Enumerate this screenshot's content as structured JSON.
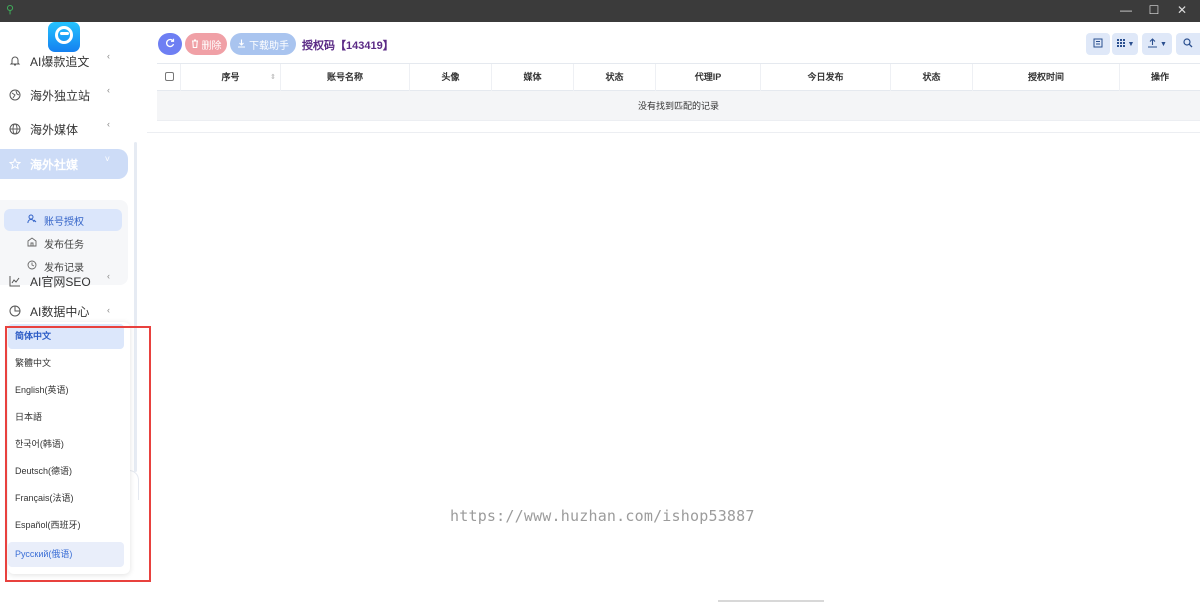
{
  "window": {
    "minimize_glyph": "—",
    "maximize_glyph": "☐",
    "close_glyph": "✕"
  },
  "sidebar": {
    "items": [
      {
        "label": "AI爆款追文",
        "icon": "bell-icon"
      },
      {
        "label": "海外独立站",
        "icon": "globe-icon"
      },
      {
        "label": "海外媒体",
        "icon": "globe-icon"
      },
      {
        "label": "海外社媒",
        "icon": "star-icon"
      },
      {
        "label": "AI官网SEO",
        "icon": "chart-line-icon"
      },
      {
        "label": "AI数据中心",
        "icon": "pie-chart-icon"
      }
    ],
    "submenu": [
      {
        "label": "账号授权",
        "icon": "user-key-icon"
      },
      {
        "label": "发布任务",
        "icon": "building-icon"
      },
      {
        "label": "发布记录",
        "icon": "clock-icon"
      }
    ]
  },
  "language_menu": {
    "options": [
      "简体中文",
      "繁體中文",
      "English(英语)",
      "日本語",
      "한국어(韩语)",
      "Deutsch(德语)",
      "Français(法语)",
      "Español(西班牙)",
      "Русский(俄语)"
    ],
    "selected": "简体中文",
    "hovered": "Русский(俄语)"
  },
  "toolbar": {
    "delete_label": "删除",
    "download_label": "下载助手",
    "auth_code_label": "授权码【143419】"
  },
  "table": {
    "columns": [
      "序号",
      "账号名称",
      "头像",
      "媒体",
      "状态",
      "代理IP",
      "今日发布",
      "状态",
      "授权时间",
      "操作"
    ],
    "empty_message": "没有找到匹配的记录"
  },
  "watermark": "https://www.huzhan.com/ishop53887",
  "colors": {
    "accent": "#3464c8",
    "refresh_button": "#6e7ff3",
    "delete_button": "#f0a0a6",
    "download_button": "#a9c4ef",
    "title_purple": "#5b2b86",
    "highlight_red": "#e8413e"
  }
}
